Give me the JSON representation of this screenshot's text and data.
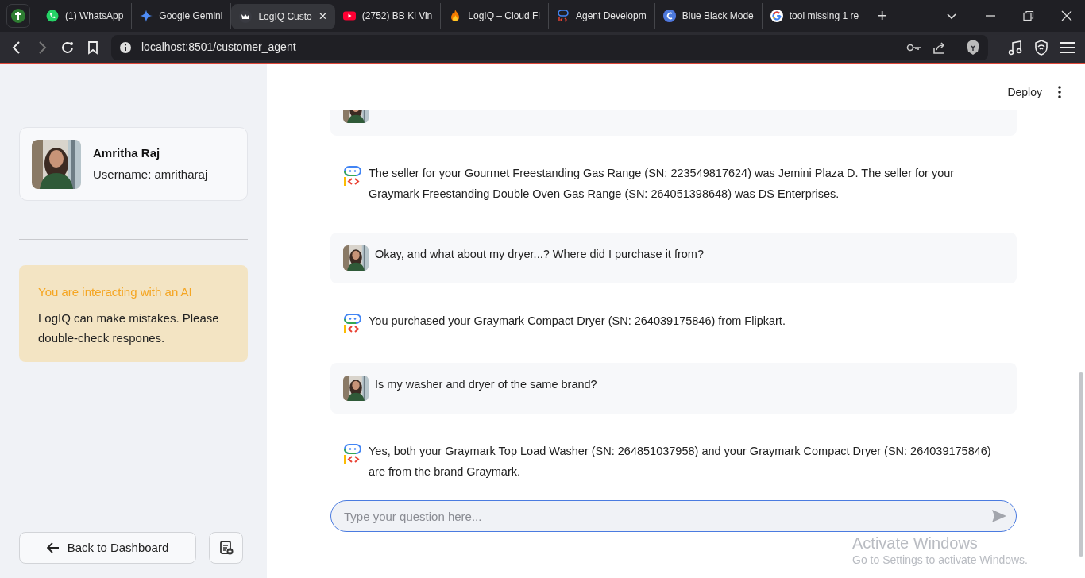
{
  "browser": {
    "tabs": [
      {
        "title": "(1) WhatsApp",
        "selected": false
      },
      {
        "title": "Google Gemini",
        "selected": false
      },
      {
        "title": "LogIQ Custo",
        "selected": true,
        "close": "✕"
      },
      {
        "title": "(2752) BB Ki Vin",
        "selected": false
      },
      {
        "title": "LogIQ – Cloud Fi",
        "selected": false
      },
      {
        "title": "Agent Developm",
        "selected": false
      },
      {
        "title": "Blue Black Mode",
        "selected": false
      },
      {
        "title": "tool missing 1 re",
        "selected": false
      }
    ],
    "new_tab": "+",
    "address": "localhost:8501/customer_agent"
  },
  "sidebar": {
    "profile": {
      "name": "Amritha Raj",
      "username": "Username: amritharaj"
    },
    "notice": {
      "title": "You are interacting with an AI",
      "body": "LogIQ can make mistakes. Please double-check respones."
    },
    "back_button": "Back to Dashboard"
  },
  "header": {
    "deploy": "Deploy"
  },
  "messages": [
    {
      "kind": "user",
      "cut": true
    },
    {
      "kind": "assistant",
      "text": "The seller for your Gourmet Freestanding Gas Range (SN: 223549817624) was Jemini Plaza D. The seller for your Graymark Freestanding Double Oven Gas Range (SN: 264051398648) was DS Enterprises."
    },
    {
      "kind": "user",
      "text": "Okay, and what about my dryer...? Where did I purchase it from?"
    },
    {
      "kind": "assistant",
      "text": "You purchased your Graymark Compact Dryer (SN: 264039175846) from Flipkart."
    },
    {
      "kind": "user",
      "text": "Is my washer and dryer of the same brand?"
    },
    {
      "kind": "assistant",
      "text": "Yes, both your Graymark Top Load Washer (SN: 264851037958) and your Graymark Compact Dryer (SN: 264039175846) are from the brand Graymark."
    }
  ],
  "chat_input": {
    "placeholder": "Type your question here..."
  },
  "os_notice": {
    "title": "Activate Windows",
    "body": "Go to Settings to activate Windows."
  }
}
